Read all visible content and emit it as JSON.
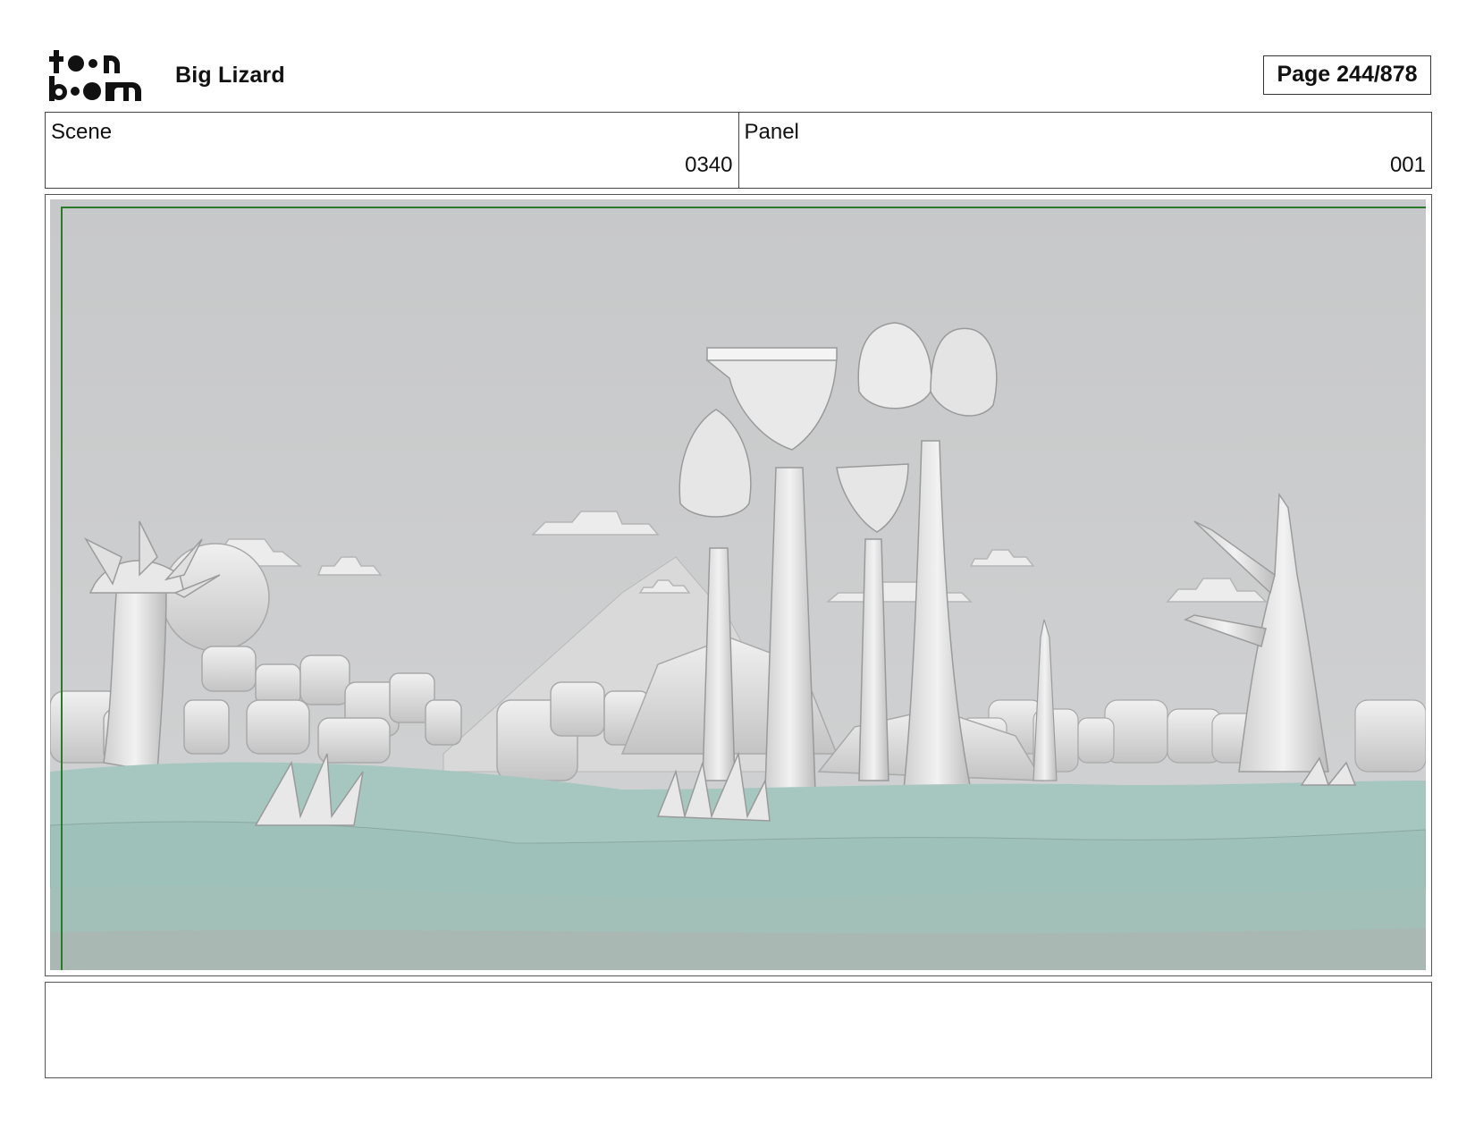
{
  "header": {
    "logo_text_top": "toon",
    "logo_text_bottom": "boom",
    "project_title": "Big Lizard",
    "page_indicator": "Page 244/878"
  },
  "info": {
    "scene_label": "Scene",
    "scene_value": "0340",
    "panel_label": "Panel",
    "panel_value": "001"
  },
  "panel": {
    "image_icon": "storyboard-panel-illustration",
    "safe_frame_color": "#2a7a2a",
    "sky_color": "#cbcccd",
    "ground_color": "#a3c6bf"
  },
  "notes": {
    "text": ""
  }
}
